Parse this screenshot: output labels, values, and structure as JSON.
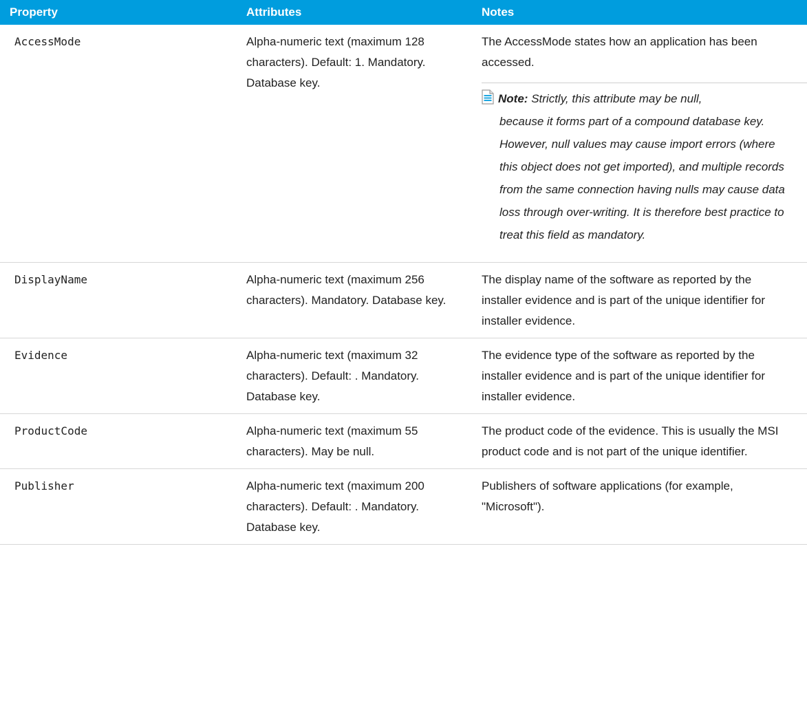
{
  "table": {
    "headers": [
      "Property",
      "Attributes",
      "Notes"
    ],
    "rows": [
      {
        "property": "AccessMode",
        "attributes": "Alpha-numeric text (maximum 128 characters). Default: 1. Mandatory. Database key.",
        "notes": "The AccessMode states how an application has been accessed.",
        "note_label": "Note:",
        "note_first_line": "Strictly, this attribute may be null,",
        "note_rest": "because it forms part of a compound database key. However, null values may cause import errors (where this object does not get imported), and multiple records from the same connection having nulls may cause data loss through over-writing. It is therefore best practice to treat this field as mandatory.",
        "note_icon": "note-document-icon"
      },
      {
        "property": "DisplayName",
        "attributes": "Alpha-numeric text (maximum 256 characters). Mandatory. Database key.",
        "notes": "The display name of the software as reported by the installer evidence and is part of the unique identifier for installer evidence."
      },
      {
        "property": "Evidence",
        "attributes": "Alpha-numeric text (maximum 32 characters). Default: . Mandatory. Database key.",
        "notes": "The evidence type of the software as reported by the installer evidence and is part of the unique identifier for installer evidence."
      },
      {
        "property": "ProductCode",
        "attributes": "Alpha-numeric text (maximum 55 characters). May be null.",
        "notes": "The product code of the evidence. This is usually the MSI product code and is not part of the unique identifier."
      },
      {
        "property": "Publisher",
        "attributes": "Alpha-numeric text (maximum 200 characters). Default: . Mandatory. Database key.",
        "notes": "Publishers of software applications (for example, \"Microsoft\")."
      }
    ]
  },
  "colors": {
    "header_bg": "#009dde",
    "header_text": "#ffffff",
    "row_border": "#d7d7d7",
    "icon_accent": "#1ea7e1"
  }
}
